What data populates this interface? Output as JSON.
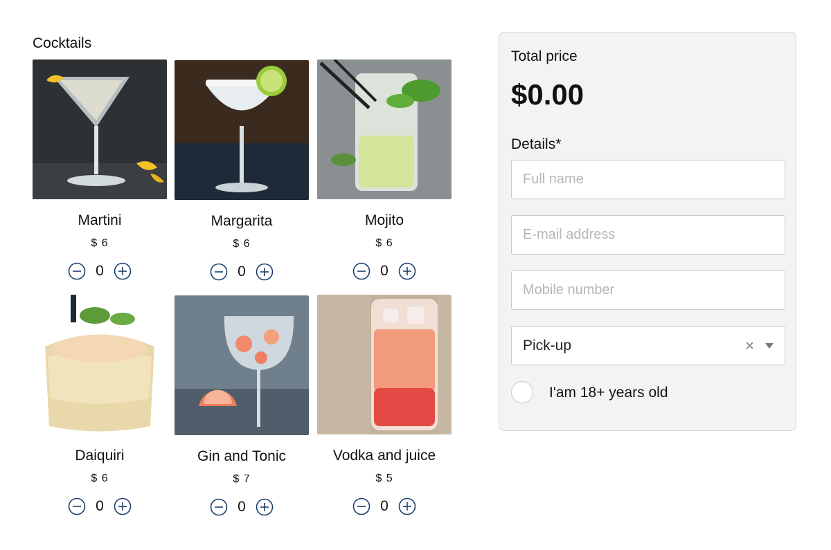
{
  "section_title": "Cocktails",
  "cocktails": [
    {
      "name": "Martini",
      "price": "$ 6",
      "qty": "0"
    },
    {
      "name": "Margarita",
      "price": "$ 6",
      "qty": "0"
    },
    {
      "name": "Mojito",
      "price": "$ 6",
      "qty": "0"
    },
    {
      "name": "Daiquiri",
      "price": "$ 6",
      "qty": "0"
    },
    {
      "name": "Gin and Tonic",
      "price": "$ 7",
      "qty": "0"
    },
    {
      "name": "Vodka and juice",
      "price": "$ 5",
      "qty": "0"
    }
  ],
  "icons": {
    "minus": "minus-circle-icon",
    "plus": "plus-circle-icon",
    "clear": "close-icon",
    "caret": "chevron-down-icon"
  },
  "colors": {
    "accent": "#1a3f6f",
    "panel_bg": "#f3f3f3"
  },
  "order": {
    "total_label": "Total price",
    "total_value": "$0.00",
    "details_label": "Details*",
    "full_name_placeholder": "Full name",
    "email_placeholder": "E-mail address",
    "mobile_placeholder": "Mobile number",
    "delivery_value": "Pick-up",
    "clear_symbol": "×",
    "age_label": "I'am 18+ years old"
  }
}
